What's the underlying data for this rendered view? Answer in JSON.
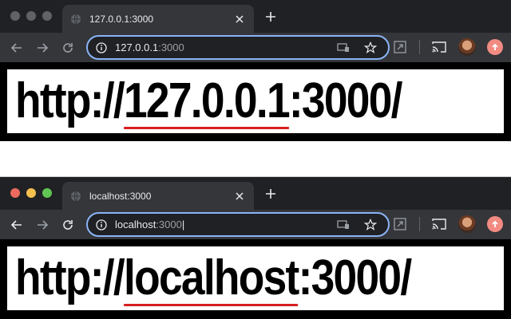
{
  "window_top": {
    "traffic_lights_active": false,
    "tab": {
      "title": "127.0.0.1:3000",
      "icon": "globe-icon"
    },
    "address_bar": {
      "host": "127.0.0.1",
      "port": ":3000",
      "icons": [
        "info-icon",
        "cast-tab-icon",
        "star-icon"
      ]
    },
    "page_text": {
      "prefix": "http://",
      "highlight": "127.0.0.1",
      "suffix": ":3000/"
    }
  },
  "window_bottom": {
    "traffic_lights_active": true,
    "tab": {
      "title": "localhost:3000",
      "icon": "globe-icon"
    },
    "address_bar": {
      "host": "localhost",
      "port": ":3000",
      "icons": [
        "info-icon",
        "cast-tab-icon",
        "star-icon"
      ]
    },
    "page_text": {
      "prefix": "http://",
      "highlight": "localhost",
      "suffix": ":3000/"
    }
  },
  "toolbar_icons": [
    "back-icon",
    "forward-icon",
    "reload-icon",
    "extension-icon",
    "cast-icon",
    "avatar",
    "update-icon"
  ],
  "colors": {
    "titlebar": "#202124",
    "toolbar": "#35363a",
    "omnibox_border": "#8ab4f8",
    "underline": "#d62020",
    "update_badge": "#f28b82"
  }
}
